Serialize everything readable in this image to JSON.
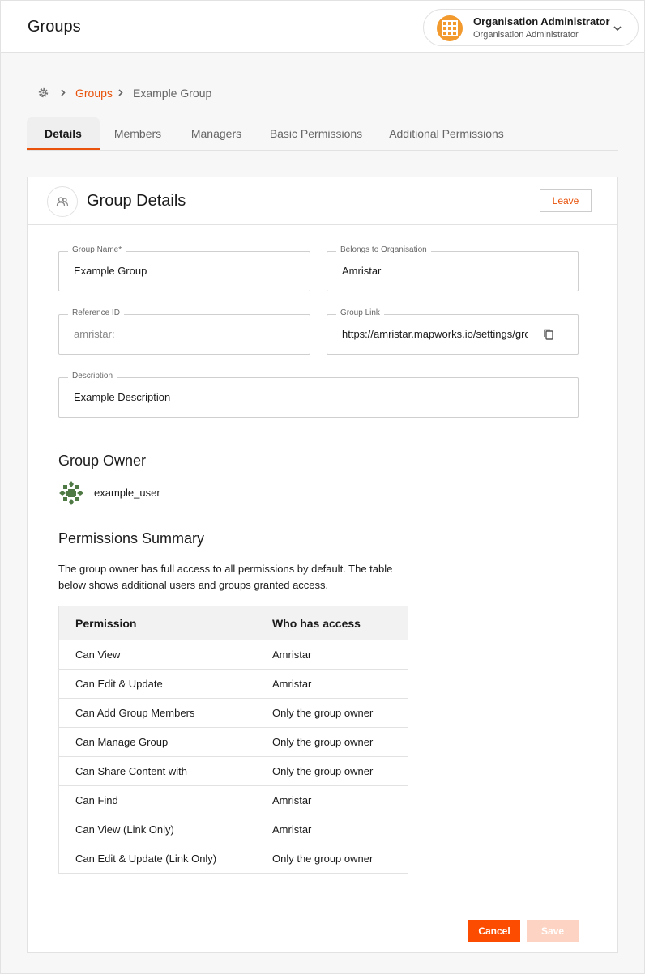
{
  "header": {
    "title": "Groups",
    "user": {
      "name": "Organisation Administrator",
      "role": "Organisation Administrator",
      "avatar_icon": "building-grid-icon",
      "menu_icon": "chevron-down-icon"
    }
  },
  "breadcrumb": {
    "home_icon": "gear-icon",
    "link": "Groups",
    "current": "Example Group"
  },
  "tabs": [
    {
      "label": "Details",
      "active": true
    },
    {
      "label": "Members",
      "active": false
    },
    {
      "label": "Managers",
      "active": false
    },
    {
      "label": "Basic Permissions",
      "active": false
    },
    {
      "label": "Additional Permissions",
      "active": false
    }
  ],
  "card": {
    "icon": "group-icon",
    "title": "Group Details",
    "leave_label": "Leave"
  },
  "form": {
    "group_name": {
      "label": "Group Name*",
      "value": "Example Group"
    },
    "organisation": {
      "label": "Belongs to Organisation",
      "value": "Amristar"
    },
    "reference_id": {
      "label": "Reference ID",
      "value": "amristar:"
    },
    "group_link": {
      "label": "Group Link",
      "value": "https://amristar.mapworks.io/settings/groups/example",
      "copy_icon": "copy-icon"
    },
    "description": {
      "label": "Description",
      "value": "Example Description"
    }
  },
  "owner": {
    "title": "Group Owner",
    "username": "example_user"
  },
  "permissions": {
    "title": "Permissions Summary",
    "intro": "The group owner has full access to all permissions by default. The table below shows additional users and groups granted access.",
    "columns": [
      "Permission",
      "Who has access"
    ],
    "rows": [
      {
        "permission": "Can View",
        "access": "Amristar"
      },
      {
        "permission": "Can Edit & Update",
        "access": "Amristar"
      },
      {
        "permission": "Can Add Group Members",
        "access": "Only the group owner"
      },
      {
        "permission": "Can Manage Group",
        "access": "Only the group owner"
      },
      {
        "permission": "Can Share Content with",
        "access": "Only the group owner"
      },
      {
        "permission": "Can Find",
        "access": "Amristar"
      },
      {
        "permission": "Can View (Link Only)",
        "access": "Amristar"
      },
      {
        "permission": "Can Edit & Update (Link Only)",
        "access": "Only the group owner"
      }
    ]
  },
  "actions": {
    "cancel_label": "Cancel",
    "save_label": "Save"
  },
  "colors": {
    "accent": "#e8520a",
    "primary_button": "#fc4c02",
    "disabled_button": "#fdd4c3"
  }
}
